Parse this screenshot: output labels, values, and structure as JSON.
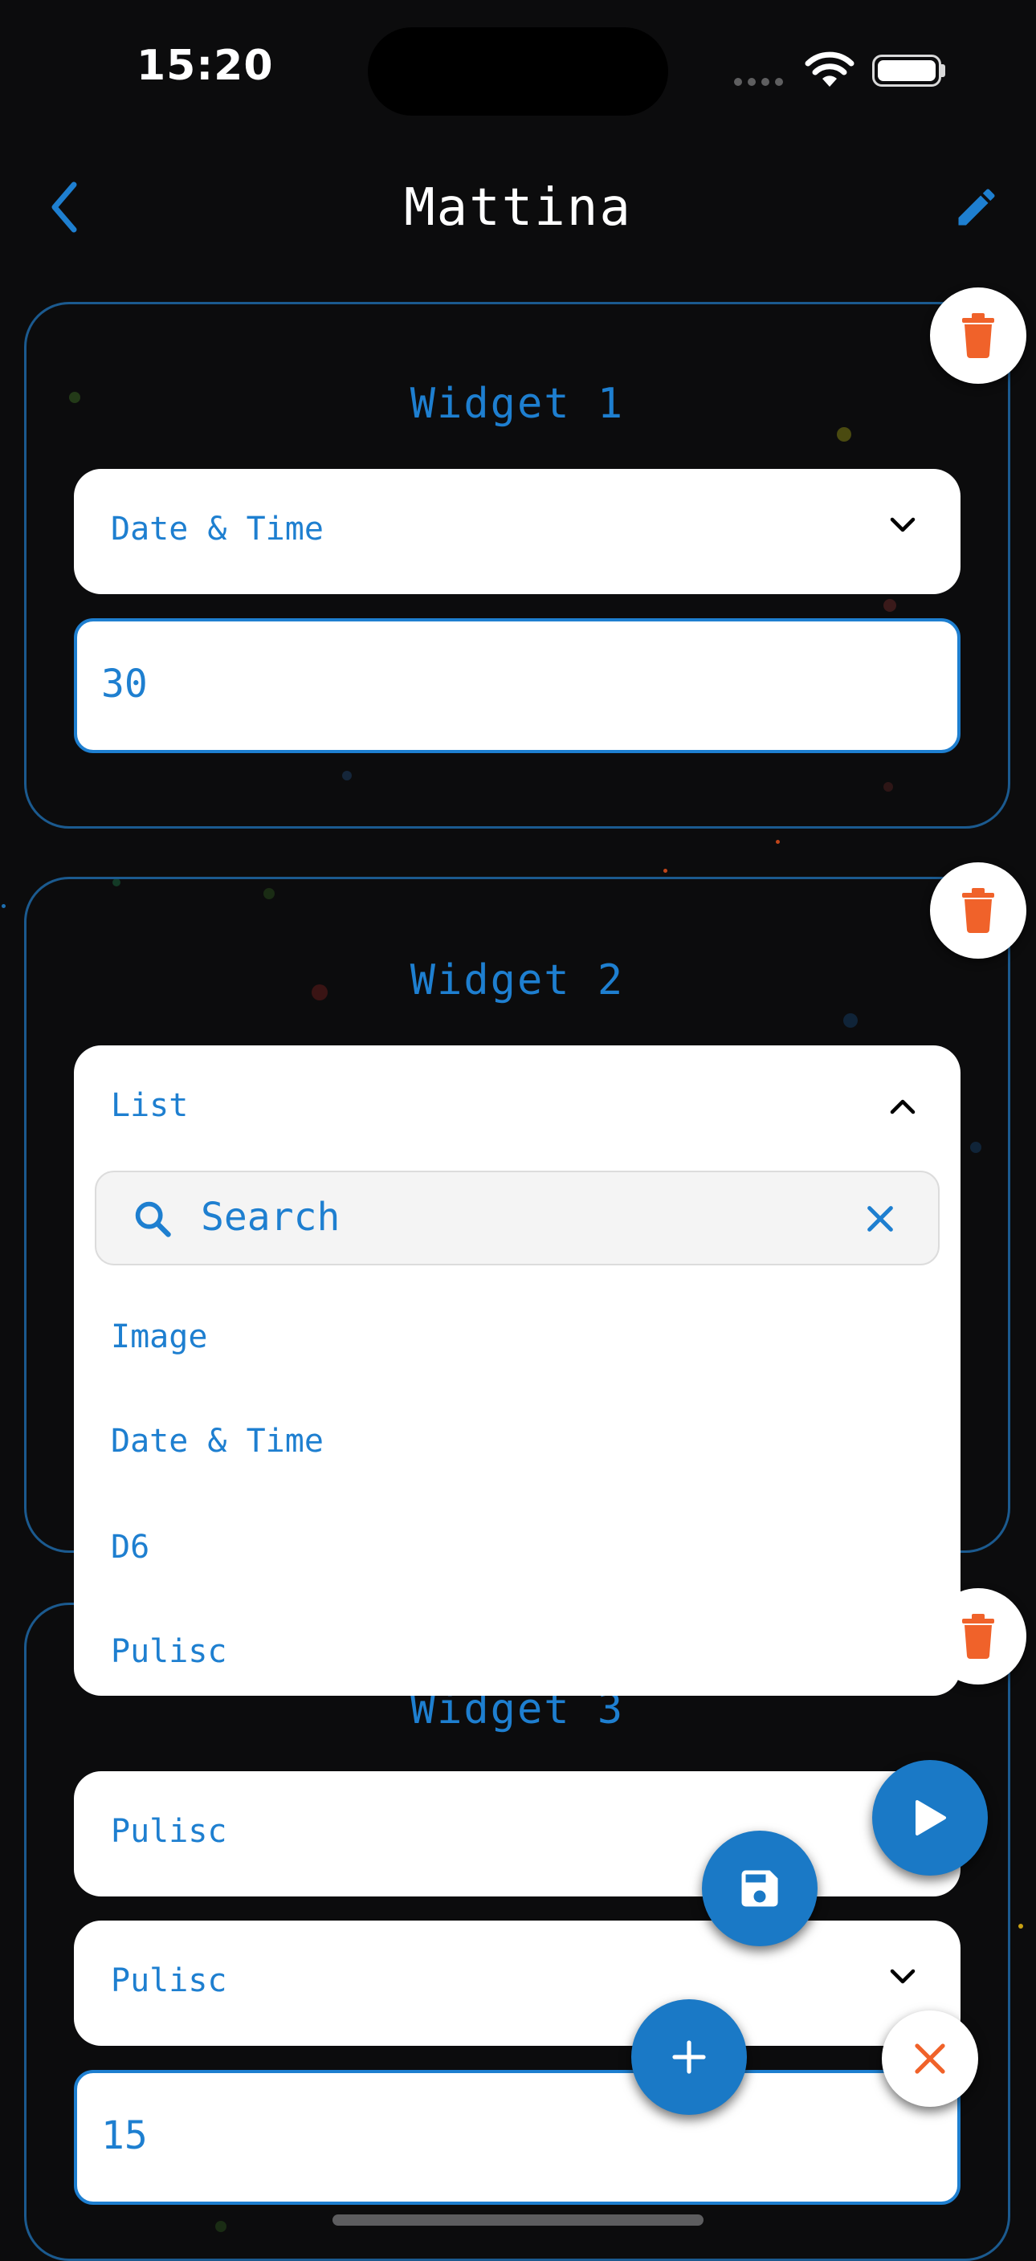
{
  "status_bar": {
    "time": "15:20"
  },
  "header": {
    "title": "Mattina"
  },
  "widgets": [
    {
      "title": "Widget 1",
      "select": "Date & Time",
      "input": "30"
    },
    {
      "title": "Widget 2",
      "select": "List",
      "dropdown": {
        "search_placeholder": "Search",
        "options": [
          "Image",
          "Date & Time",
          "D6",
          "Pulisc"
        ]
      }
    },
    {
      "title": "Widget 3",
      "select_a": "Pulisc",
      "select_b": "Pulisc",
      "input": "15"
    }
  ],
  "icons": {
    "back": "chevron-left-icon",
    "edit": "pencil-icon",
    "delete": "trash-icon",
    "play": "play-icon",
    "save": "floppy-disk-icon",
    "add": "plus-icon",
    "close": "close-icon"
  },
  "colors": {
    "accent": "#1e7fd0",
    "danger": "#f0622a",
    "background": "#0c0c0d"
  }
}
